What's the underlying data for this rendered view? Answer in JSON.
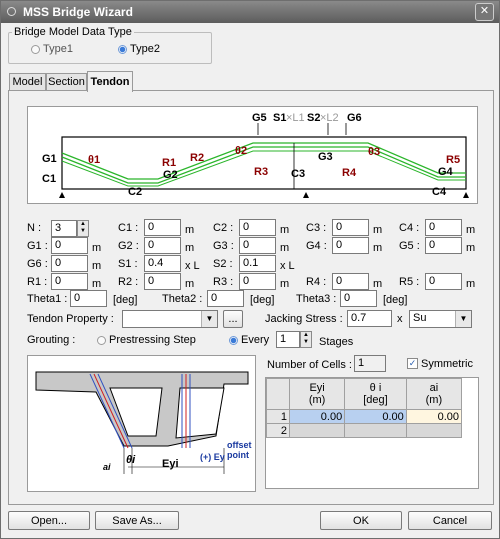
{
  "window": {
    "title": "MSS Bridge Wizard",
    "close_glyph": "✕"
  },
  "model_type": {
    "legend": "Bridge Model Data Type",
    "options": [
      "Type1",
      "Type2"
    ],
    "selected": "Type2"
  },
  "tabs": [
    "Model",
    "Section",
    "Tendon"
  ],
  "active_tab": "Tendon",
  "diagram": {
    "top_labels": {
      "g5": "G5",
      "s1": "S1",
      "xl1": "×L1",
      "s2": "S2",
      "xl2": "×L2",
      "g6": "G6"
    },
    "side_labels": {
      "g1": "G1",
      "c1": "C1",
      "theta1": "θ1",
      "r1": "R1",
      "r2": "R2",
      "g2": "G2",
      "c2": "C2",
      "theta2": "θ2",
      "g3": "G3",
      "r3": "R3",
      "c3": "C3",
      "r4": "R4",
      "theta3": "θ3",
      "r5": "R5",
      "g4": "G4",
      "c4": "C4"
    }
  },
  "fields": {
    "n_label": "N :",
    "n_value": "3",
    "c1_label": "C1 :",
    "c1_value": "0",
    "c1_unit": "m",
    "c2_label": "C2 :",
    "c2_value": "0",
    "c2_unit": "m",
    "c3_label": "C3 :",
    "c3_value": "0",
    "c3_unit": "m",
    "c4_label": "C4 :",
    "c4_value": "0",
    "c4_unit": "m",
    "g1_label": "G1 :",
    "g1_value": "0",
    "g1_unit": "m",
    "g2_label": "G2 :",
    "g2_value": "0",
    "g2_unit": "m",
    "g3_label": "G3 :",
    "g3_value": "0",
    "g3_unit": "m",
    "g4_label": "G4 :",
    "g4_value": "0",
    "g4_unit": "m",
    "g5_label": "G5 :",
    "g5_value": "0",
    "g5_unit": "m",
    "g6_label": "G6 :",
    "g6_value": "0",
    "g6_unit": "m",
    "s1_label": "S1 :",
    "s1_value": "0.4",
    "s1_unit": "x L",
    "s2_label": "S2 :",
    "s2_value": "0.1",
    "s2_unit": "x L",
    "r1_label": "R1 :",
    "r1_value": "0",
    "r1_unit": "m",
    "r2_label": "R2 :",
    "r2_value": "0",
    "r2_unit": "m",
    "r3_label": "R3 :",
    "r3_value": "0",
    "r3_unit": "m",
    "r4_label": "R4 :",
    "r4_value": "0",
    "r4_unit": "m",
    "r5_label": "R5 :",
    "r5_value": "0",
    "r5_unit": "m",
    "theta1_label": "Theta1 :",
    "theta1_value": "0",
    "theta1_unit": "[deg]",
    "theta2_label": "Theta2 :",
    "theta2_value": "0",
    "theta2_unit": "[deg]",
    "theta3_label": "Theta3 :",
    "theta3_value": "0",
    "theta3_unit": "[deg]"
  },
  "tendon_property": {
    "label": "Tendon Property :",
    "value": "",
    "browse_label": "..."
  },
  "jacking": {
    "label": "Jacking Stress :",
    "value": "0.7",
    "times": "x",
    "unit_value": "Su"
  },
  "grouting": {
    "label": "Grouting :",
    "opt1": "Prestressing Step",
    "opt2": "Every",
    "selected": "Every",
    "stages_value": "1",
    "stages_label": "Stages"
  },
  "section_image": {
    "theta": "θi",
    "ai": "ai",
    "eyi": "Eyi",
    "ey_dir": "(+) Ey",
    "offset": "offset",
    "point": "point"
  },
  "cells": {
    "label": "Number of Cells :",
    "value": "1",
    "symmetric_label": "Symmetric",
    "symmetric_checked": true
  },
  "table": {
    "headers": [
      {
        "line1": "Eyi",
        "line2": "(m)"
      },
      {
        "line1": "θ i",
        "line2": "[deg]"
      },
      {
        "line1": "ai",
        "line2": "(m)"
      }
    ],
    "rows": [
      {
        "no": "1",
        "eyi": "0.00",
        "theta": "0.00",
        "ai": "0.00"
      },
      {
        "no": "2",
        "eyi": "",
        "theta": "",
        "ai": ""
      }
    ]
  },
  "buttons": {
    "open": "Open...",
    "save_as": "Save As...",
    "ok": "OK",
    "cancel": "Cancel"
  },
  "colors": {
    "label_red": "#8b0000",
    "tendon_green": "#2bb52b",
    "selection_blue": "#b8d0f0"
  }
}
